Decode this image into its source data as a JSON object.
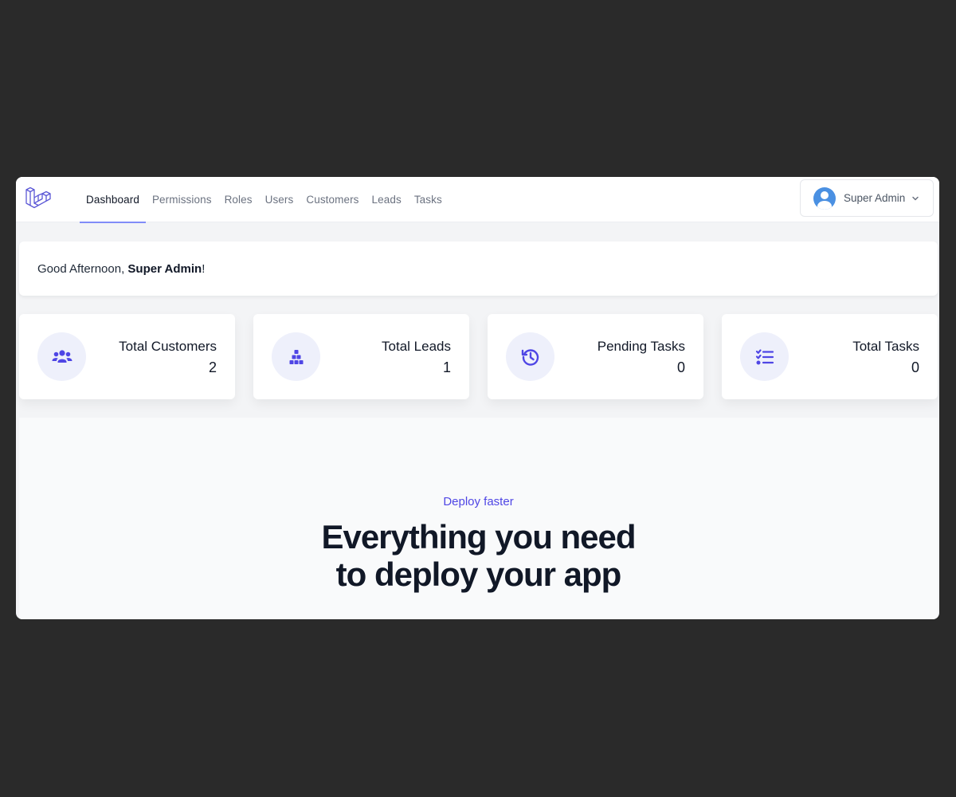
{
  "nav": {
    "logo_icon": "laravel-logo-icon",
    "links": [
      "Dashboard",
      "Permissions",
      "Roles",
      "Users",
      "Customers",
      "Leads",
      "Tasks"
    ],
    "active": "Dashboard",
    "user": {
      "name": "Super Admin",
      "avatar_icon": "user-avatar-icon",
      "chevron_icon": "chevron-down-icon"
    }
  },
  "greeting": {
    "prefix": "Good Afternoon, ",
    "name": "Super Admin",
    "suffix": "!"
  },
  "stats": [
    {
      "label": "Total Customers",
      "value": "2",
      "icon": "users-icon"
    },
    {
      "label": "Total Leads",
      "value": "1",
      "icon": "cubes-icon"
    },
    {
      "label": "Pending Tasks",
      "value": "0",
      "icon": "history-icon"
    },
    {
      "label": "Total Tasks",
      "value": "0",
      "icon": "list-check-icon"
    }
  ],
  "hero": {
    "eyebrow": "Deploy faster",
    "headline_line1": "Everything you need",
    "headline_line2": "to deploy your app"
  },
  "colors": {
    "accent": "#4f46e5",
    "active_underline": "#818cf8",
    "icon_bg": "#eef0fb",
    "avatar": "#4a90e2",
    "backdrop": "#2a2a2a"
  }
}
